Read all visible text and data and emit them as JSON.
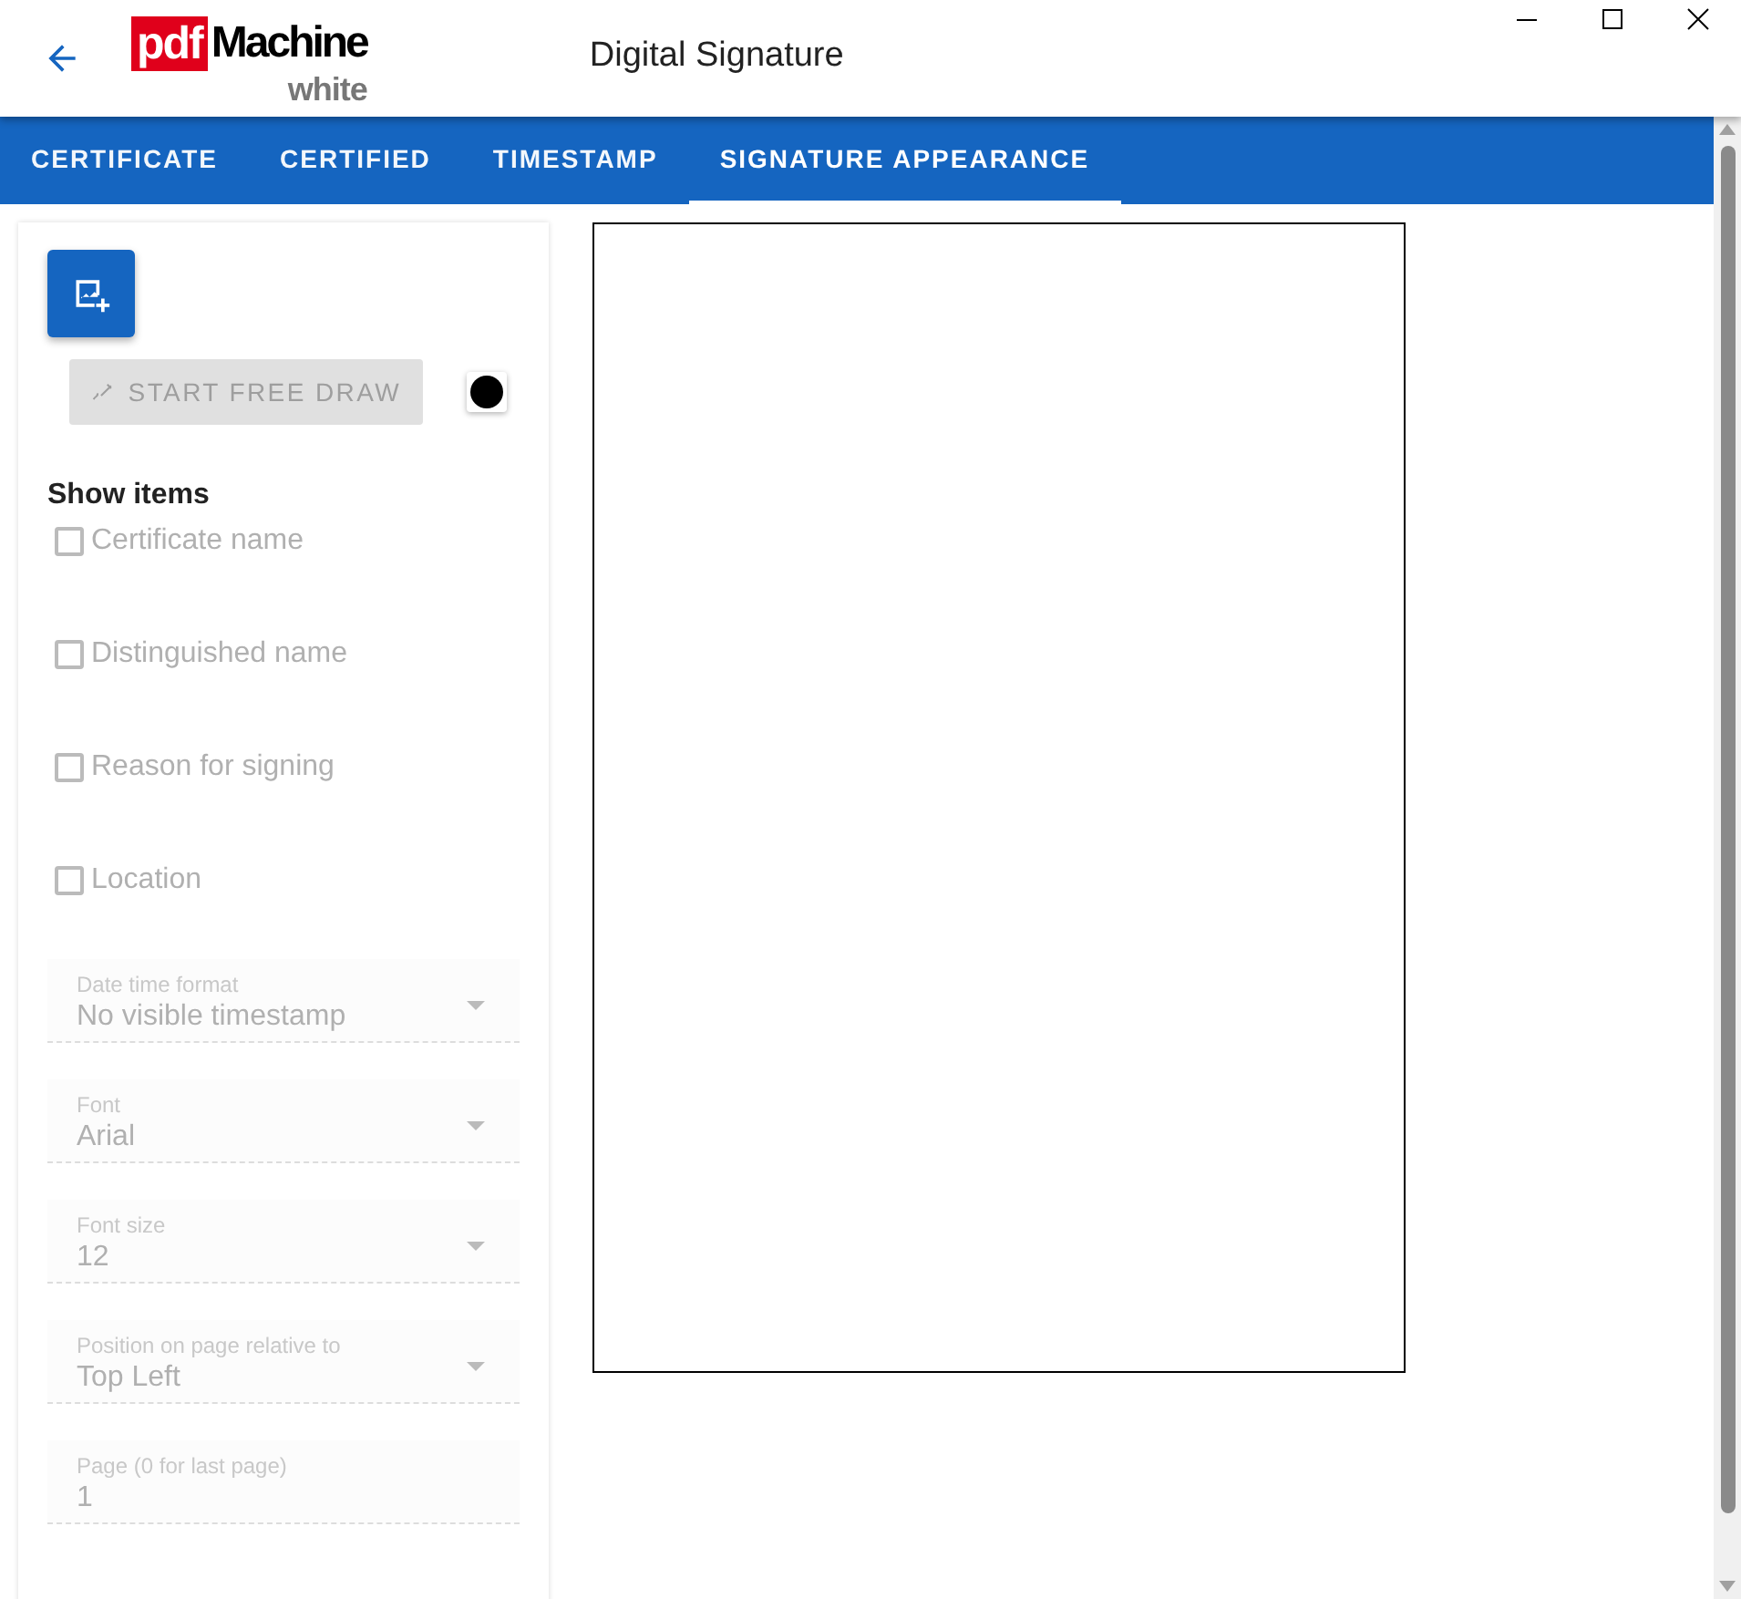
{
  "window": {
    "title": "Digital Signature"
  },
  "logo": {
    "brand": "pdf",
    "name": "Machine",
    "edition": "white"
  },
  "tabs": [
    {
      "label": "CERTIFICATE",
      "selected": false
    },
    {
      "label": "CERTIFIED",
      "selected": false
    },
    {
      "label": "TIMESTAMP",
      "selected": false
    },
    {
      "label": "SIGNATURE APPEARANCE",
      "selected": true
    }
  ],
  "free_draw": {
    "label": "START FREE DRAW",
    "disabled": true,
    "color": "#000000"
  },
  "show_items": {
    "title": "Show items",
    "items": [
      {
        "label": "Certificate name",
        "checked": false,
        "disabled": true
      },
      {
        "label": "Distinguished name",
        "checked": false,
        "disabled": true
      },
      {
        "label": "Reason for signing",
        "checked": false,
        "disabled": true
      },
      {
        "label": "Location",
        "checked": false,
        "disabled": true
      }
    ]
  },
  "fields": [
    {
      "kind": "select",
      "label": "Date time format",
      "value": "No visible timestamp",
      "disabled": true
    },
    {
      "kind": "select",
      "label": "Font",
      "value": "Arial",
      "disabled": true
    },
    {
      "kind": "select",
      "label": "Font size",
      "value": "12",
      "disabled": true
    },
    {
      "kind": "select",
      "label": "Position on page relative to",
      "value": "Top Left",
      "disabled": true
    },
    {
      "kind": "text",
      "label": "Page (0 for last page)",
      "value": "1",
      "disabled": true
    }
  ]
}
